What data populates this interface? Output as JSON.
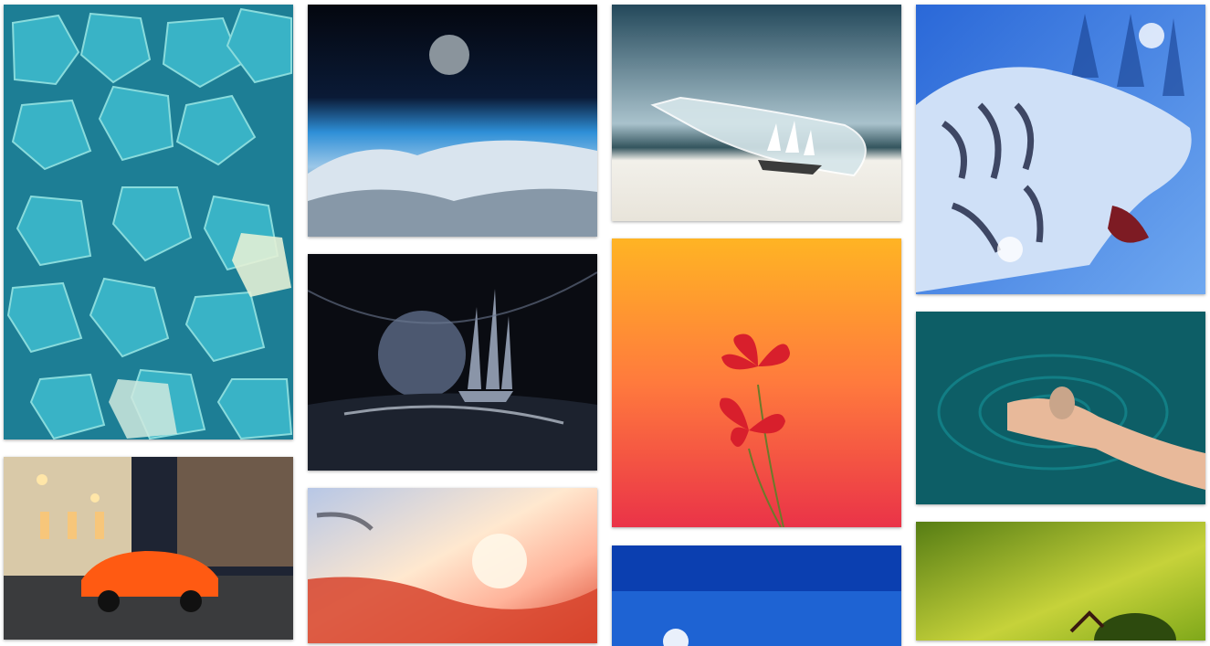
{
  "gallery": {
    "tiles": [
      {
        "id": "blue-candy",
        "subject": "blue-gummy-candies-photo",
        "colors": [
          "#3bb6c9",
          "#1d7e95",
          "#8fe0e0"
        ]
      },
      {
        "id": "earth-orbit",
        "subject": "moon-above-clouds-photo",
        "colors": [
          "#04070f",
          "#2e8fd7",
          "#d9e4ee"
        ]
      },
      {
        "id": "ship-in-bottle",
        "subject": "ship-in-bottle-on-beach-photo",
        "colors": [
          "#3e6f85",
          "#a9c2cc",
          "#f2f0ea"
        ]
      },
      {
        "id": "white-tiger",
        "subject": "white-tiger-art",
        "colors": [
          "#2a68d8",
          "#cfe0f7",
          "#1a2240"
        ]
      },
      {
        "id": "night-street-car",
        "subject": "orange-sports-car-street-photo",
        "colors": [
          "#1e2433",
          "#ff5a12",
          "#f7c67a"
        ]
      },
      {
        "id": "ghost-ship-moon",
        "subject": "ghost-ship-moon-art",
        "colors": [
          "#0a0c12",
          "#4c5870",
          "#c7d0dd"
        ]
      },
      {
        "id": "red-flower",
        "subject": "red-flower-gradient-art",
        "colors": [
          "#ffb424",
          "#ff5f45",
          "#d81f2c"
        ]
      },
      {
        "id": "hand-water",
        "subject": "hand-holding-shell-water-photo",
        "colors": [
          "#0d5e66",
          "#14878d",
          "#e8b99a"
        ]
      },
      {
        "id": "sunset-sky",
        "subject": "sunset-clouds-photo",
        "colors": [
          "#b7c7e6",
          "#ffe8cf",
          "#d7432b"
        ]
      },
      {
        "id": "blue-sky",
        "subject": "blue-sky-photo",
        "colors": [
          "#0b3fb0",
          "#1e63d3",
          "#ffffff"
        ]
      },
      {
        "id": "green-macro",
        "subject": "green-macro-photo",
        "colors": [
          "#7fa81a",
          "#c6d23a",
          "#2d4a0e"
        ]
      }
    ]
  }
}
